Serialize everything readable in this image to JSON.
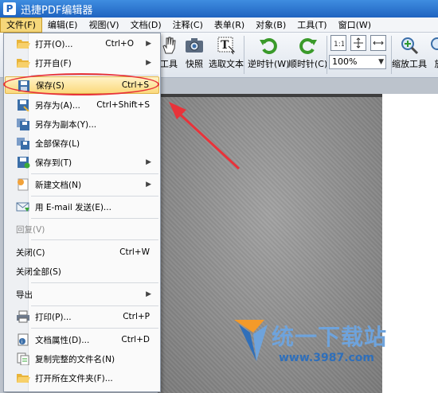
{
  "window": {
    "title": "迅捷PDF编辑器",
    "logo_letter": "P"
  },
  "menubar": [
    "文件(F)",
    "编辑(E)",
    "视图(V)",
    "文档(D)",
    "注释(C)",
    "表单(R)",
    "对象(B)",
    "工具(T)",
    "窗口(W)"
  ],
  "toolbar": {
    "tools": [
      "工具",
      "快照",
      "选取文本",
      "逆时针(W)",
      "顺时针(C)",
      "缩放工具",
      "放"
    ],
    "zoom_value": "100%"
  },
  "file_menu": [
    {
      "label": "打开(O)...",
      "shortcut": "Ctrl+O",
      "icon": "folder-open-icon",
      "submenu": true
    },
    {
      "label": "打开自(F)",
      "shortcut": "",
      "icon": "folder-open-icon",
      "submenu": true
    },
    {
      "label": "保存(S)",
      "shortcut": "Ctrl+S",
      "icon": "save-icon",
      "highlighted": true
    },
    {
      "label": "另存为(A)...",
      "shortcut": "Ctrl+Shift+S",
      "icon": "save-as-icon"
    },
    {
      "label": "另存为副本(Y)...",
      "shortcut": "",
      "icon": "save-copy-icon"
    },
    {
      "label": "全部保存(L)",
      "shortcut": "",
      "icon": "save-all-icon"
    },
    {
      "label": "保存到(T)",
      "shortcut": "",
      "icon": "save-to-icon",
      "submenu": true
    },
    {
      "label": "新建文档(N)",
      "shortcut": "",
      "icon": "new-document-icon",
      "submenu": true
    },
    {
      "label": "用 E-mail 发送(E)...",
      "shortcut": "",
      "icon": "email-icon"
    },
    {
      "label": "回复(V)",
      "shortcut": "",
      "icon": "",
      "disabled": true
    },
    {
      "label": "关闭(C)",
      "shortcut": "Ctrl+W",
      "icon": ""
    },
    {
      "label": "关闭全部(S)",
      "shortcut": "",
      "icon": ""
    },
    {
      "label": "导出",
      "shortcut": "",
      "icon": "",
      "submenu": true
    },
    {
      "label": "打印(P)...",
      "shortcut": "Ctrl+P",
      "icon": "printer-icon"
    },
    {
      "label": "文档属性(D)...",
      "shortcut": "Ctrl+D",
      "icon": "document-properties-icon"
    },
    {
      "label": "复制完整的文件名(N)",
      "shortcut": "",
      "icon": "copy-filename-icon"
    },
    {
      "label": "打开所在文件夹(F)...",
      "shortcut": "",
      "icon": "open-folder-icon"
    }
  ],
  "watermark": {
    "name": "统一下载站",
    "url": "www.3987.com"
  },
  "colors": {
    "titlebar": "#1f63c0",
    "highlight": "#fbd97c",
    "annotation_red": "#e8333a",
    "watermark_blue": "#6ea3dc"
  }
}
